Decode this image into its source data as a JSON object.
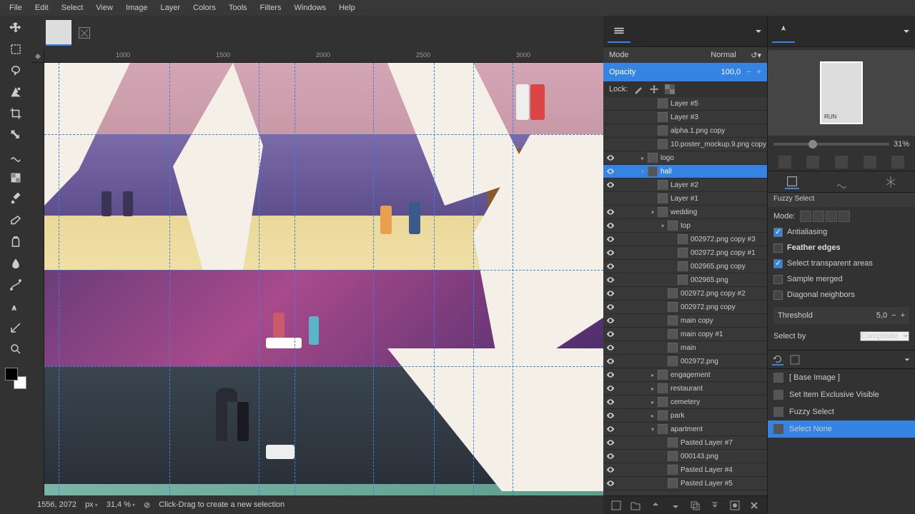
{
  "menu": {
    "items": [
      "File",
      "Edit",
      "Select",
      "View",
      "Image",
      "Layer",
      "Colors",
      "Tools",
      "Filters",
      "Windows",
      "Help"
    ]
  },
  "ruler_h": [
    "1000",
    "1500",
    "2000",
    "2500",
    "3000"
  ],
  "status": {
    "coords": "1556, 2072",
    "unit": "px",
    "zoom": "31,4 %",
    "hint": "Click-Drag to create a new selection"
  },
  "layers_panel": {
    "mode_label": "Mode",
    "mode_value": "Normal",
    "opacity_label": "Opacity",
    "opacity_value": "100,0",
    "lock_label": "Lock:",
    "items": [
      {
        "eye": false,
        "indent": 2,
        "name": "Layer #5",
        "toggle": ""
      },
      {
        "eye": false,
        "indent": 2,
        "name": "Layer #3",
        "toggle": ""
      },
      {
        "eye": false,
        "indent": 2,
        "name": "alpha.1.png copy",
        "toggle": ""
      },
      {
        "eye": false,
        "indent": 2,
        "name": "10.poster_mockup.9.png copy",
        "toggle": ""
      },
      {
        "eye": true,
        "indent": 1,
        "name": "logo",
        "toggle": "▸"
      },
      {
        "eye": true,
        "indent": 1,
        "name": "hall",
        "toggle": "▾",
        "sel": true
      },
      {
        "eye": true,
        "indent": 2,
        "name": "Layer #2",
        "toggle": ""
      },
      {
        "eye": false,
        "indent": 2,
        "name": "Layer #1",
        "toggle": ""
      },
      {
        "eye": true,
        "indent": 2,
        "name": "wedding",
        "toggle": "▾"
      },
      {
        "eye": true,
        "indent": 3,
        "name": "top",
        "toggle": "▾"
      },
      {
        "eye": true,
        "indent": 4,
        "name": "002972.png copy #3",
        "toggle": ""
      },
      {
        "eye": true,
        "indent": 4,
        "name": "002972.png copy #1",
        "toggle": ""
      },
      {
        "eye": true,
        "indent": 4,
        "name": "002965.png copy",
        "toggle": ""
      },
      {
        "eye": true,
        "indent": 4,
        "name": "002965.png",
        "toggle": ""
      },
      {
        "eye": true,
        "indent": 3,
        "name": "002972.png copy #2",
        "toggle": ""
      },
      {
        "eye": true,
        "indent": 3,
        "name": "002972.png copy",
        "toggle": ""
      },
      {
        "eye": true,
        "indent": 3,
        "name": "main copy",
        "toggle": ""
      },
      {
        "eye": true,
        "indent": 3,
        "name": "main copy #1",
        "toggle": ""
      },
      {
        "eye": true,
        "indent": 3,
        "name": "main",
        "toggle": ""
      },
      {
        "eye": true,
        "indent": 3,
        "name": "002972.png",
        "toggle": ""
      },
      {
        "eye": true,
        "indent": 2,
        "name": "engagement",
        "toggle": "▸"
      },
      {
        "eye": true,
        "indent": 2,
        "name": "restaurant",
        "toggle": "▸"
      },
      {
        "eye": true,
        "indent": 2,
        "name": "cemetery",
        "toggle": "▸"
      },
      {
        "eye": true,
        "indent": 2,
        "name": "park",
        "toggle": "▸"
      },
      {
        "eye": true,
        "indent": 2,
        "name": "apartment",
        "toggle": "▾"
      },
      {
        "eye": true,
        "indent": 3,
        "name": "Pasted Layer #7",
        "toggle": ""
      },
      {
        "eye": true,
        "indent": 3,
        "name": "000143.png",
        "toggle": ""
      },
      {
        "eye": true,
        "indent": 3,
        "name": "Pasted Layer #4",
        "toggle": ""
      },
      {
        "eye": true,
        "indent": 3,
        "name": "Pasted Layer #5",
        "toggle": ""
      }
    ]
  },
  "nav": {
    "zoom": "31%"
  },
  "tool_options": {
    "title": "Fuzzy Select",
    "mode_label": "Mode:",
    "antialias": "Antialiasing",
    "feather": "Feather edges",
    "transparent": "Select transparent areas",
    "sample": "Sample merged",
    "diagonal": "Diagonal neighbors",
    "threshold_label": "Threshold",
    "threshold_value": "5,0",
    "selectby_label": "Select by",
    "selectby_value": "Composite"
  },
  "undo": {
    "items": [
      {
        "name": "[ Base Image ]"
      },
      {
        "name": "Set Item Exclusive Visible"
      },
      {
        "name": "Fuzzy Select"
      },
      {
        "name": "Select None",
        "sel": true
      }
    ]
  }
}
